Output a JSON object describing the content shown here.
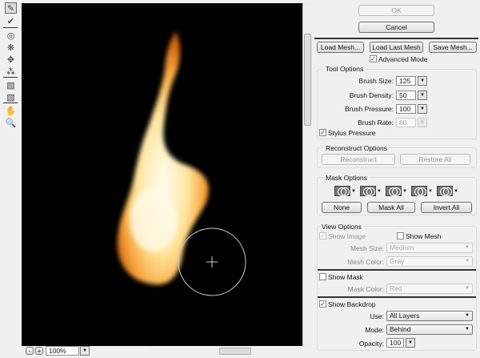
{
  "toolbar": {
    "tools": [
      "forward-warp",
      "reconstruct",
      "twirl-clockwise",
      "pucker",
      "bloat",
      "push-left",
      "freeze-mask",
      "thaw-mask",
      "hand",
      "zoom"
    ]
  },
  "zoom": {
    "value": "100%",
    "minus": "-",
    "plus": "+"
  },
  "buttons": {
    "ok": "OK",
    "cancel": "Cancel",
    "load_mesh": "Load Mesh...",
    "load_last_mesh": "Load Last Mesh",
    "save_mesh": "Save Mesh..."
  },
  "advanced_mode": {
    "label": "Advanced Mode",
    "checked": true
  },
  "tool_options": {
    "title": "Tool Options",
    "brush_size_label": "Brush Size:",
    "brush_size": "125",
    "brush_density_label": "Brush Density:",
    "brush_density": "50",
    "brush_pressure_label": "Brush Pressure:",
    "brush_pressure": "100",
    "brush_rate_label": "Brush Rate:",
    "brush_rate": "80",
    "stylus_label": "Stylus Pressure"
  },
  "reconstruct_options": {
    "title": "Reconstruct Options",
    "reconstruct": "Reconstruct",
    "restore_all": "Restore All"
  },
  "mask_options": {
    "title": "Mask Options",
    "none": "None",
    "mask_all": "Mask All",
    "invert_all": "Invert All"
  },
  "view_options": {
    "title": "View Options",
    "show_image": "Show Image",
    "show_mesh": "Show Mesh",
    "mesh_size_label": "Mesh Size:",
    "mesh_size": "Medium",
    "mesh_color_label": "Mesh Color:",
    "mesh_color": "Gray",
    "show_mask": "Show Mask",
    "mask_color_label": "Mask Color:",
    "mask_color": "Red",
    "show_backdrop": "Show Backdrop",
    "use_label": "Use:",
    "use": "All Layers",
    "mode_label": "Mode:",
    "mode": "Behind",
    "opacity_label": "Opacity:",
    "opacity": "100"
  }
}
